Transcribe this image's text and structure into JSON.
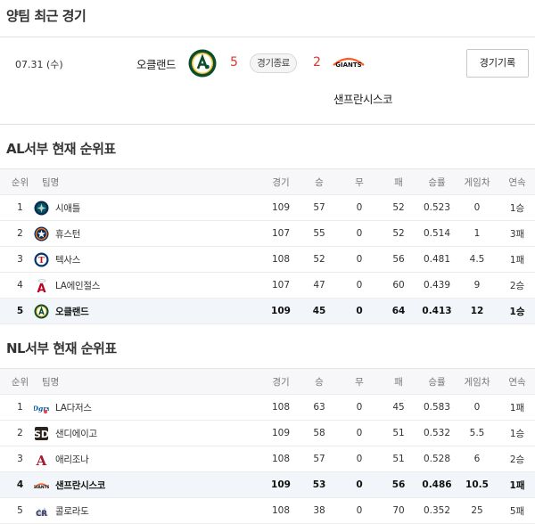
{
  "recent": {
    "title": "양팀 최근 경기",
    "date": "07.31 (수)",
    "home_team": "오클랜드",
    "home_score": "5",
    "status": "경기종료",
    "away_score": "2",
    "away_team": "샌프란시스코",
    "record_button": "경기기록"
  },
  "al": {
    "title": "AL서부 현재 순위표",
    "headers": [
      "순위",
      "팀명",
      "경기",
      "승",
      "무",
      "패",
      "승률",
      "게임차",
      "연속"
    ],
    "rows": [
      {
        "rank": "1",
        "team": "시애틀",
        "logo": "mariners-logo",
        "g": "109",
        "w": "57",
        "d": "0",
        "l": "52",
        "pct": "0.523",
        "gb": "0",
        "streak": "1승"
      },
      {
        "rank": "2",
        "team": "휴스턴",
        "logo": "astros-logo",
        "g": "107",
        "w": "55",
        "d": "0",
        "l": "52",
        "pct": "0.514",
        "gb": "1",
        "streak": "3패"
      },
      {
        "rank": "3",
        "team": "텍사스",
        "logo": "rangers-logo",
        "g": "108",
        "w": "52",
        "d": "0",
        "l": "56",
        "pct": "0.481",
        "gb": "4.5",
        "streak": "1패"
      },
      {
        "rank": "4",
        "team": "LA에인절스",
        "logo": "angels-logo",
        "g": "107",
        "w": "47",
        "d": "0",
        "l": "60",
        "pct": "0.439",
        "gb": "9",
        "streak": "2승"
      },
      {
        "rank": "5",
        "team": "오클랜드",
        "logo": "athletics-logo",
        "g": "109",
        "w": "45",
        "d": "0",
        "l": "64",
        "pct": "0.413",
        "gb": "12",
        "streak": "1승"
      }
    ]
  },
  "nl": {
    "title": "NL서부 현재 순위표",
    "headers": [
      "순위",
      "팀명",
      "경기",
      "승",
      "무",
      "패",
      "승률",
      "게임차",
      "연속"
    ],
    "rows": [
      {
        "rank": "1",
        "team": "LA다저스",
        "logo": "dodgers-logo",
        "g": "108",
        "w": "63",
        "d": "0",
        "l": "45",
        "pct": "0.583",
        "gb": "0",
        "streak": "1패"
      },
      {
        "rank": "2",
        "team": "샌디에이고",
        "logo": "padres-logo",
        "g": "109",
        "w": "58",
        "d": "0",
        "l": "51",
        "pct": "0.532",
        "gb": "5.5",
        "streak": "1승"
      },
      {
        "rank": "3",
        "team": "애리조나",
        "logo": "diamondbacks-logo",
        "g": "108",
        "w": "57",
        "d": "0",
        "l": "51",
        "pct": "0.528",
        "gb": "6",
        "streak": "2승"
      },
      {
        "rank": "4",
        "team": "샌프란시스코",
        "logo": "giants-logo",
        "g": "109",
        "w": "53",
        "d": "0",
        "l": "56",
        "pct": "0.486",
        "gb": "10.5",
        "streak": "1패"
      },
      {
        "rank": "5",
        "team": "콜로라도",
        "logo": "rockies-logo",
        "g": "108",
        "w": "38",
        "d": "0",
        "l": "70",
        "pct": "0.352",
        "gb": "25",
        "streak": "5패"
      }
    ]
  },
  "colors": {
    "home_score": "#e0352b",
    "away_score": "#e0352b",
    "highlight_row": "#f2f5f9"
  }
}
